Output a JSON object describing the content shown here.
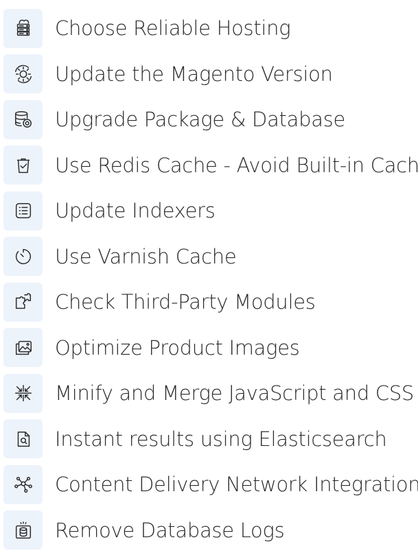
{
  "items": [
    {
      "label": "Choose Reliable Hosting",
      "icon": "server-cloud-icon"
    },
    {
      "label": "Update the Magento Version",
      "icon": "gear-refresh-icon"
    },
    {
      "label": "Upgrade Package & Database",
      "icon": "database-sync-icon"
    },
    {
      "label": "Use Redis Cache - Avoid Built-in Cache",
      "icon": "trash-check-icon"
    },
    {
      "label": "Update Indexers",
      "icon": "list-icon"
    },
    {
      "label": "Use Varnish Cache",
      "icon": "timer-icon"
    },
    {
      "label": "Check Third-Party Modules",
      "icon": "puzzle-icon"
    },
    {
      "label": "Optimize Product Images",
      "icon": "image-icon"
    },
    {
      "label": "Minify and Merge JavaScript and CSS",
      "icon": "compress-arrows-icon"
    },
    {
      "label": "Instant results using Elasticsearch",
      "icon": "document-search-icon"
    },
    {
      "label": "Content Delivery Network Integration",
      "icon": "network-nodes-icon"
    },
    {
      "label": "Remove Database Logs",
      "icon": "database-box-icon"
    }
  ],
  "colors": {
    "icon_background": "#edf3fb",
    "text": "#2c2c2c",
    "icon_stroke": "#2e2e2e"
  }
}
